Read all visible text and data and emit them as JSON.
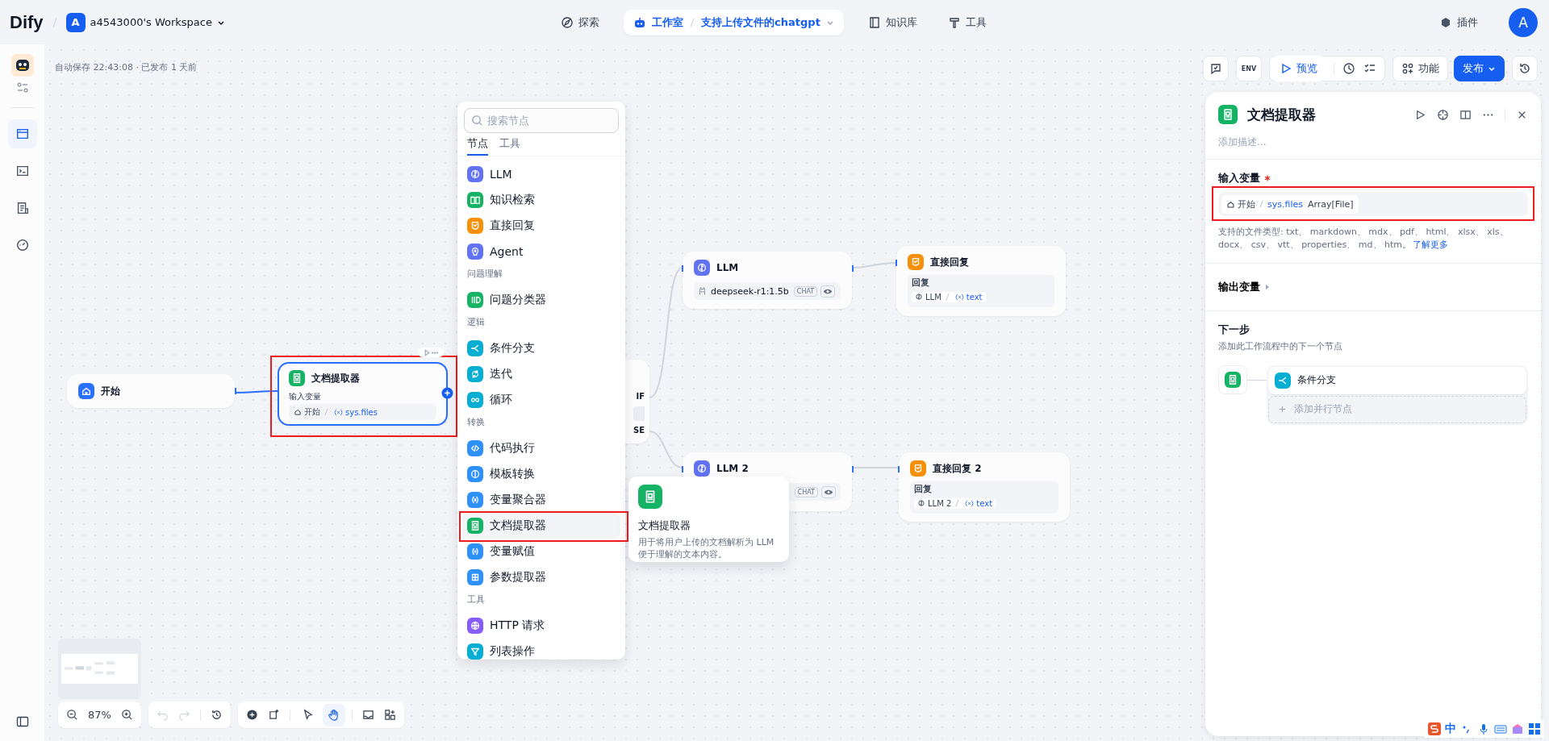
{
  "header": {
    "brand": "Dify",
    "workspace": {
      "initial": "A",
      "name": "a4543000's Workspace"
    },
    "nav": [
      {
        "kind": "explore",
        "label": "探索",
        "selected": false
      },
      {
        "kind": "studio",
        "label": "工作室",
        "app": "支持上传文件的chatgpt",
        "selected": true
      },
      {
        "kind": "knowledge",
        "label": "知识库",
        "selected": false
      },
      {
        "kind": "tools",
        "label": "工具",
        "selected": false
      }
    ],
    "plugins": "插件",
    "avatar": "A"
  },
  "sidebar": {
    "items": [
      {
        "selected": true
      },
      {
        "selected": false
      },
      {
        "selected": false
      },
      {
        "selected": false
      }
    ]
  },
  "status": "自动保存 22:43:08 · 已发布 1 天前",
  "toolbar": {
    "env": "ENV",
    "preview": "预览",
    "features": "功能",
    "publish": "发布"
  },
  "canvas": {
    "start": {
      "kind": "start",
      "title": "开始"
    },
    "extractor": {
      "kind": "doc",
      "title": "文档提取器",
      "selected": true,
      "annotated": true,
      "field_label": "输入变量",
      "variable": {
        "node": "开始",
        "name": "sys.files"
      }
    },
    "branch": {
      "cases": [
        "IF",
        "SE"
      ]
    },
    "llm": {
      "kind": "llm",
      "title": "LLM",
      "model": "deepseek-r1:1.5b",
      "mode": "CHAT"
    },
    "answer": {
      "kind": "answer",
      "title": "直接回复",
      "field_label": "回复",
      "variable": {
        "kind": "llm",
        "node": "LLM",
        "name": "text"
      }
    },
    "llm2": {
      "kind": "llm",
      "title": "LLM 2",
      "mode": "CHAT"
    },
    "answer2": {
      "kind": "answer",
      "title": "直接回复 2",
      "field_label": "回复",
      "variable": {
        "kind": "llm",
        "node": "LLM 2",
        "name": "text"
      }
    }
  },
  "node_menu": {
    "placeholder": "搜索节点",
    "tabs": [
      {
        "label": "节点",
        "selected": true
      },
      {
        "label": "工具",
        "selected": false
      }
    ],
    "entries": [
      {
        "kind": "llm",
        "label": "LLM",
        "selected": false,
        "annotated": false
      },
      {
        "kind": "knowledge",
        "label": "知识检索",
        "selected": false,
        "annotated": false
      },
      {
        "kind": "answer",
        "label": "直接回复",
        "selected": false,
        "annotated": false
      },
      {
        "kind": "agent",
        "label": "Agent",
        "selected": false,
        "annotated": false
      },
      {
        "kind": "group",
        "label": "问题理解"
      },
      {
        "kind": "classifier",
        "label": "问题分类器",
        "selected": false,
        "annotated": false
      },
      {
        "kind": "group",
        "label": "逻辑"
      },
      {
        "kind": "ifelse",
        "label": "条件分支",
        "selected": false,
        "annotated": false
      },
      {
        "kind": "iteration",
        "label": "迭代",
        "selected": false,
        "annotated": false
      },
      {
        "kind": "loop",
        "label": "循环",
        "selected": false,
        "annotated": false
      },
      {
        "kind": "group",
        "label": "转换"
      },
      {
        "kind": "code",
        "label": "代码执行",
        "selected": false,
        "annotated": false
      },
      {
        "kind": "template",
        "label": "模板转换",
        "selected": false,
        "annotated": false
      },
      {
        "kind": "aggregator",
        "label": "变量聚合器",
        "selected": false,
        "annotated": false
      },
      {
        "kind": "doc",
        "label": "文档提取器",
        "selected": true,
        "annotated": true
      },
      {
        "kind": "assigner",
        "label": "变量赋值",
        "selected": false,
        "annotated": false
      },
      {
        "kind": "param",
        "label": "参数提取器",
        "selected": false,
        "annotated": false
      },
      {
        "kind": "group",
        "label": "工具"
      },
      {
        "kind": "http",
        "label": "HTTP 请求",
        "selected": false,
        "annotated": false
      },
      {
        "kind": "list",
        "label": "列表操作",
        "selected": false,
        "annotated": false
      }
    ]
  },
  "tooltip": {
    "kind": "doc",
    "title": "文档提取器",
    "description": "用于将用户上传的文档解析为 LLM 便于理解的文本内容。"
  },
  "panel": {
    "kind": "doc",
    "title": "文档提取器",
    "description_placeholder": "添加描述...",
    "input": {
      "label": "输入变量",
      "required": true,
      "annotated": true,
      "variable": {
        "node": "开始",
        "name": "sys.files",
        "value_type": "Array[File]"
      }
    },
    "help": "支持的文件类型: txt、 markdown、 mdx、 pdf、 html、 xlsx、 xls、 docx、 csv、 vtt、 properties、 md、 htm。",
    "help_link": "了解更多",
    "output": {
      "label": "输出变量",
      "expanded": false
    },
    "next": {
      "title": "下一步",
      "hint": "添加此工作流程中的下一个节点",
      "node": {
        "kind": "ifelse",
        "label": "条件分支"
      },
      "add_parallel": "添加并行节点"
    }
  },
  "zoom": "87%",
  "tools": [
    {
      "kind": "pointer",
      "selected": false
    },
    {
      "kind": "hand",
      "selected": true
    }
  ],
  "ime": "中"
}
